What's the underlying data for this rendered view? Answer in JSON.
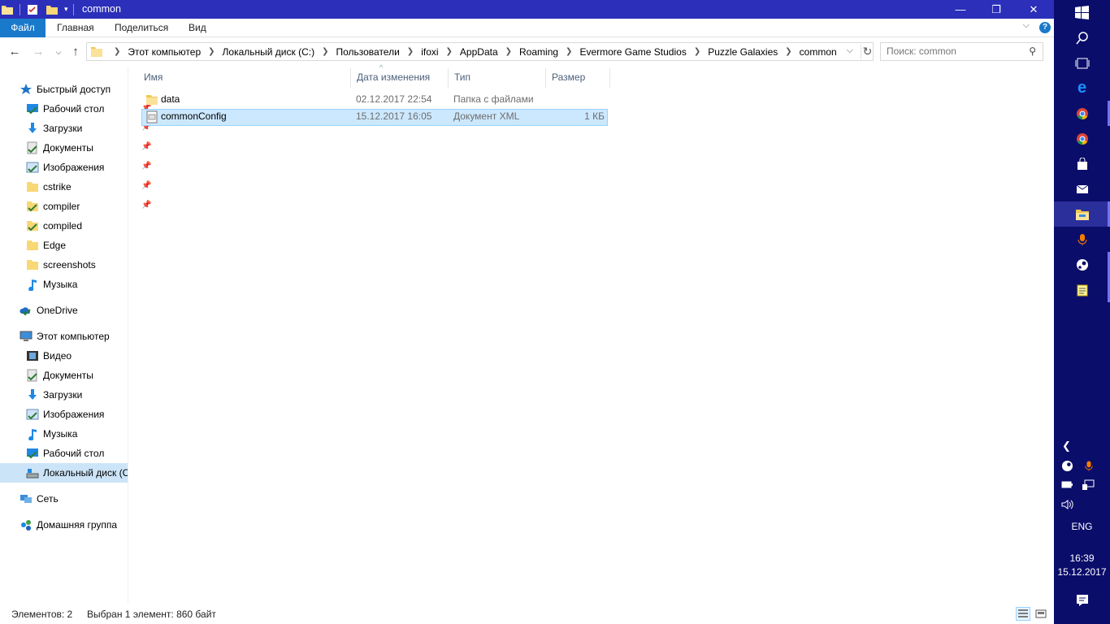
{
  "window": {
    "title": "common",
    "caption_minimize": "—",
    "caption_maximize": "❐",
    "caption_close": "✕"
  },
  "ribbon": {
    "tabs": [
      "Файл",
      "Главная",
      "Поделиться",
      "Вид"
    ],
    "help": "?"
  },
  "address": {
    "crumbs": [
      "Этот компьютер",
      "Локальный диск (C:)",
      "Пользователи",
      "ifoxi",
      "AppData",
      "Roaming",
      "Evermore Game Studios",
      "Puzzle Galaxies",
      "common"
    ],
    "search_placeholder": "Поиск: common"
  },
  "nav": {
    "quick_access": "Быстрый доступ",
    "quick_items": [
      {
        "label": "Рабочий стол",
        "icon": "desktop-icon",
        "pinned": true
      },
      {
        "label": "Загрузки",
        "icon": "downloads-icon",
        "pinned": true
      },
      {
        "label": "Документы",
        "icon": "documents-icon",
        "pinned": true
      },
      {
        "label": "Изображения",
        "icon": "pictures-icon",
        "pinned": true
      },
      {
        "label": "cstrike",
        "icon": "folder-icon",
        "pinned": true
      },
      {
        "label": "compiler",
        "icon": "folder-icon",
        "pinned": true
      },
      {
        "label": "compiled",
        "icon": "folder-icon",
        "pinned": false
      },
      {
        "label": "Edge",
        "icon": "folder-icon",
        "pinned": false
      },
      {
        "label": "screenshots",
        "icon": "folder-icon",
        "pinned": false
      },
      {
        "label": "Музыка",
        "icon": "music-icon",
        "pinned": false
      }
    ],
    "onedrive": "OneDrive",
    "this_pc": "Этот компьютер",
    "pc_items": [
      {
        "label": "Видео",
        "icon": "video-icon"
      },
      {
        "label": "Документы",
        "icon": "documents-icon"
      },
      {
        "label": "Загрузки",
        "icon": "downloads-icon"
      },
      {
        "label": "Изображения",
        "icon": "pictures-icon"
      },
      {
        "label": "Музыка",
        "icon": "music-icon"
      },
      {
        "label": "Рабочий стол",
        "icon": "desktop-icon"
      },
      {
        "label": "Локальный диск (C",
        "icon": "drive-icon",
        "selected": true
      }
    ],
    "network": "Сеть",
    "homegroup": "Домашняя группа"
  },
  "list": {
    "headers": [
      "Имя",
      "Дата изменения",
      "Тип",
      "Размер"
    ],
    "rows": [
      {
        "name": "data",
        "date": "02.12.2017 22:54",
        "type": "Папка с файлами",
        "size": "",
        "icon": "folder-icon",
        "selected": false
      },
      {
        "name": "commonConfig",
        "date": "15.12.2017 16:05",
        "type": "Документ XML",
        "size": "1 КБ",
        "icon": "xml-file-icon",
        "selected": true
      }
    ]
  },
  "status": {
    "count": "Элементов: 2",
    "selection": "Выбран 1 элемент: 860 байт"
  },
  "taskbar": {
    "language": "ENG",
    "time": "16:39",
    "date": "15.12.2017"
  }
}
